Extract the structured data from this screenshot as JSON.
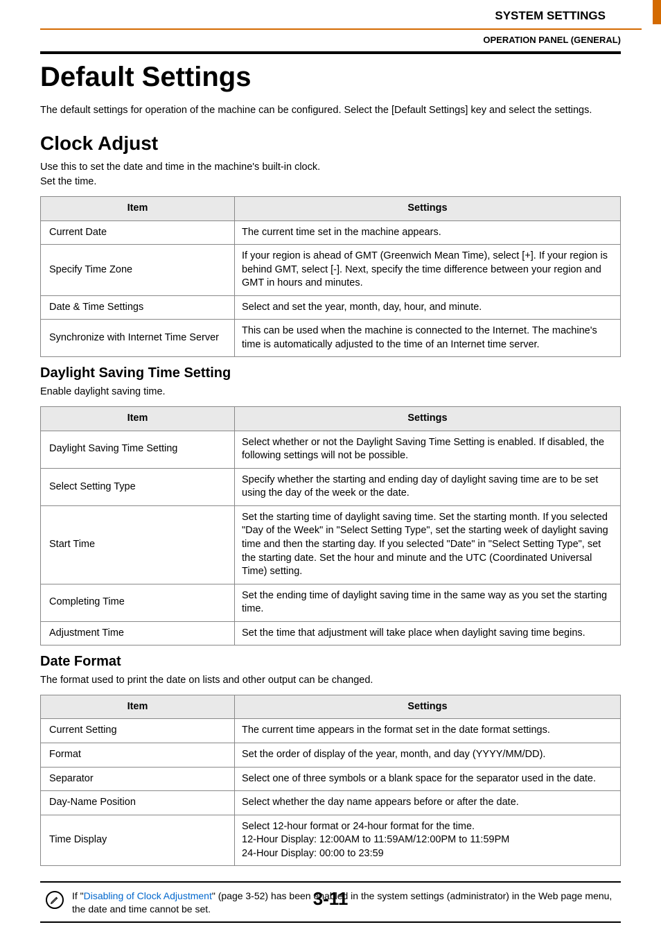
{
  "header": {
    "chapter": "SYSTEM SETTINGS",
    "subsection": "OPERATION PANEL (GENERAL)"
  },
  "title": "Default Settings",
  "intro": "The default settings for operation of the machine can be configured. Select the [Default Settings] key and select the settings.",
  "clock": {
    "heading": "Clock Adjust",
    "desc1": "Use this to set the date and time in the machine's built-in clock.",
    "desc2": "Set the time.",
    "table": {
      "col_item": "Item",
      "col_settings": "Settings",
      "rows": [
        {
          "item": "Current Date",
          "settings": "The current time set in the machine appears."
        },
        {
          "item": "Specify Time Zone",
          "settings": "If your region is ahead of GMT (Greenwich Mean Time), select [+]. If your region is behind GMT, select [-]. Next, specify the time difference between your region and GMT in hours and minutes."
        },
        {
          "item": "Date & Time Settings",
          "settings": "Select and set the year, month, day, hour, and minute."
        },
        {
          "item": "Synchronize with Internet Time Server",
          "settings": "This can be used when the machine is connected to the Internet. The machine's time is automatically adjusted to the time of an Internet time server."
        }
      ]
    }
  },
  "dst": {
    "heading": "Daylight Saving Time Setting",
    "desc": "Enable daylight saving time.",
    "table": {
      "col_item": "Item",
      "col_settings": "Settings",
      "rows": [
        {
          "item": "Daylight Saving Time Setting",
          "settings": "Select whether or not the Daylight Saving Time Setting is enabled. If disabled, the following settings will not be possible."
        },
        {
          "item": "Select Setting Type",
          "settings": "Specify whether the starting and ending day of daylight saving time are to be set using the day of the week or the date."
        },
        {
          "item": "Start Time",
          "settings": "Set the starting time of daylight saving time. Set the starting month. If you selected \"Day of the Week\" in \"Select Setting Type\", set the starting week of daylight saving time and then the starting day. If you selected \"Date\" in \"Select Setting Type\", set the starting date. Set the hour and minute and the UTC (Coordinated Universal Time) setting."
        },
        {
          "item": "Completing Time",
          "settings": "Set the ending time of daylight saving time in the same way as you set the starting time."
        },
        {
          "item": "Adjustment Time",
          "settings": "Set the time that adjustment will take place when daylight saving time begins."
        }
      ]
    }
  },
  "dateformat": {
    "heading": "Date Format",
    "desc": "The format used to print the date on lists and other output can be changed.",
    "table": {
      "col_item": "Item",
      "col_settings": "Settings",
      "rows": [
        {
          "item": "Current Setting",
          "settings": "The current time appears in the format set in the date format settings."
        },
        {
          "item": "Format",
          "settings": "Set the order of display of the year, month, and day (YYYY/MM/DD)."
        },
        {
          "item": "Separator",
          "settings": "Select one of three symbols or a blank space for the separator used in the date."
        },
        {
          "item": "Day-Name Position",
          "settings": "Select whether the day name appears before or after the date."
        },
        {
          "item": "Time Display",
          "settings": "Select 12-hour format or 24-hour format for the time.\n12-Hour Display: 12:00AM to 11:59AM/12:00PM to 11:59PM\n24-Hour Display: 00:00 to 23:59"
        }
      ]
    }
  },
  "note": {
    "pre": "If \"",
    "link": "Disabling of Clock Adjustment",
    "post": "\" (page 3-52) has been enabled in the system settings (administrator) in the Web page menu, the date and time cannot be set."
  },
  "page_number": "3-11"
}
